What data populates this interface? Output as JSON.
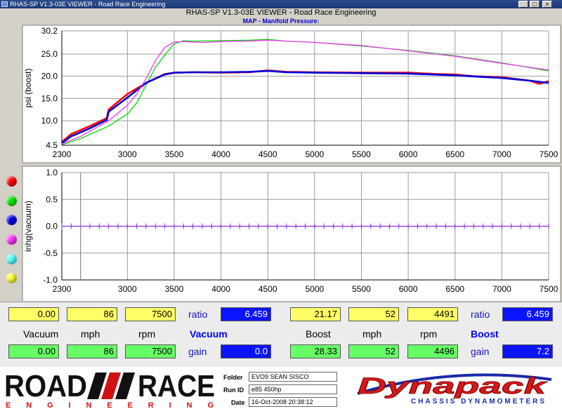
{
  "window": {
    "title": "RHAS-SP V1.3-03E VIEWER - Road Race Engineering"
  },
  "app_title": "RHAS-SP V1.3-03E VIEWER - Road Race Engineering",
  "chart_data": [
    {
      "type": "line",
      "title": "MAP - Manifold Pressure:",
      "xlabel": "",
      "ylabel": "psi (boost)",
      "xlim": [
        2300,
        7500
      ],
      "ylim": [
        4.5,
        30.2
      ],
      "yticks": [
        4.5,
        10.0,
        15.0,
        20.0,
        25.0,
        30.2
      ],
      "ytick_labels": [
        "4.5",
        "10.0",
        "15.0",
        "20.0",
        "25.0",
        "30.2"
      ],
      "xticks": [
        2300,
        3000,
        3500,
        4000,
        4500,
        5000,
        5500,
        6000,
        6500,
        7000,
        7500
      ],
      "grid": true,
      "series": [
        {
          "color": "#ff0000",
          "x": [
            2300,
            2400,
            2600,
            2780,
            2800,
            3000,
            3200,
            3400,
            3500,
            3700,
            4000,
            4300,
            4500,
            4700,
            5000,
            5500,
            6000,
            6300,
            6500,
            6700,
            7000,
            7300,
            7400,
            7500
          ],
          "y": [
            5.2,
            7.0,
            8.8,
            10.6,
            12.5,
            16.0,
            18.5,
            20.5,
            20.8,
            20.9,
            20.8,
            20.9,
            21.3,
            21.0,
            20.9,
            20.8,
            20.8,
            20.5,
            20.4,
            20.0,
            19.8,
            19.0,
            18.3,
            18.9
          ]
        },
        {
          "color": "#00dd00",
          "x": [
            2300,
            2500,
            2800,
            3000,
            3100,
            3200,
            3300,
            3400,
            3500,
            3600,
            3700,
            4000,
            4300,
            4500,
            4700,
            5000,
            5500,
            6000,
            6500,
            7000,
            7500
          ],
          "y": [
            4.6,
            6.0,
            8.8,
            11.5,
            14.0,
            18.0,
            22.0,
            24.8,
            27.3,
            28.0,
            27.9,
            28.0,
            28.1,
            28.3,
            27.9,
            27.6,
            26.8,
            25.8,
            24.6,
            23.0,
            21.2
          ]
        },
        {
          "color": "#0000dd",
          "x": [
            2300,
            2400,
            2600,
            2780,
            2800,
            3000,
            3200,
            3400,
            3500,
            3700,
            4000,
            4300,
            4500,
            4700,
            5000,
            5500,
            6000,
            6500,
            7000,
            7300,
            7500
          ],
          "y": [
            5.0,
            6.5,
            8.3,
            10.2,
            12.0,
            15.2,
            18.5,
            20.4,
            20.8,
            20.9,
            20.9,
            21.0,
            21.2,
            20.9,
            20.8,
            20.7,
            20.6,
            20.2,
            19.6,
            19.0,
            18.5
          ]
        },
        {
          "color": "#ff33ff",
          "x": [
            2300,
            2500,
            2800,
            3000,
            3100,
            3200,
            3300,
            3400,
            3500,
            3600,
            3800,
            4000,
            4300,
            4500,
            4700,
            5000,
            5500,
            6000,
            6500,
            7000,
            7500
          ],
          "y": [
            4.8,
            6.5,
            10.0,
            13.5,
            16.0,
            19.5,
            23.5,
            26.5,
            27.7,
            27.8,
            27.6,
            27.8,
            27.9,
            28.1,
            27.9,
            27.6,
            26.9,
            25.7,
            24.5,
            22.9,
            21.4
          ]
        }
      ]
    },
    {
      "type": "line",
      "title": "",
      "xlabel": "",
      "ylabel": "inhg(vacuum)",
      "xlim": [
        2300,
        7500
      ],
      "ylim": [
        -1.0,
        1.0
      ],
      "yticks": [
        -1.0,
        -0.5,
        0.0,
        0.5,
        1.0
      ],
      "ytick_labels": [
        "-1.0",
        "-0.5",
        "0.0",
        "0.5",
        "1.0"
      ],
      "xticks": [
        2300,
        3000,
        3500,
        4000,
        4500,
        5000,
        5500,
        6000,
        6500,
        7000,
        7500
      ],
      "grid": true,
      "series": [
        {
          "color": "#8a2be2",
          "x": [
            2300,
            7500
          ],
          "y": [
            0.0,
            0.0
          ]
        }
      ]
    }
  ],
  "series_colors": [
    "#ff0000",
    "#00ee00",
    "#0000ee",
    "#ff33ff",
    "#55ffff",
    "#ffff33"
  ],
  "panel": {
    "vac_row1": [
      "0.00",
      "86",
      "7500"
    ],
    "vac_labels": [
      "Vacuum",
      "mph",
      "rpm"
    ],
    "vac_row2": [
      "0.00",
      "86",
      "7500"
    ],
    "vac_ratio_label": "ratio",
    "vac_ratio": "6.459",
    "vac_title": "Vacuum",
    "vac_gain_label": "gain",
    "vac_gain": "0.0",
    "boost_row1": [
      "21.17",
      "52",
      "4491"
    ],
    "boost_labels": [
      "Boost",
      "mph",
      "rpm"
    ],
    "boost_row2": [
      "28.33",
      "52",
      "4496"
    ],
    "boost_ratio_label": "ratio",
    "boost_ratio": "6.459",
    "boost_title": "Boost",
    "boost_gain_label": "gain",
    "boost_gain": "7.2"
  },
  "footer": {
    "logo_word1": "ROAD",
    "logo_word2": "RACE",
    "logo_sub": "ENGINEERING",
    "folder_label": "Folder",
    "folder": "EVO9 SEAN SISCO",
    "runid_label": "Run ID",
    "runid": "e85 450hp",
    "date_label": "Date",
    "date": "16-Oct-2008  20:38:12",
    "brand": "Dynapack",
    "brand_sub": "CHASSIS DYNAMOMETERS"
  }
}
